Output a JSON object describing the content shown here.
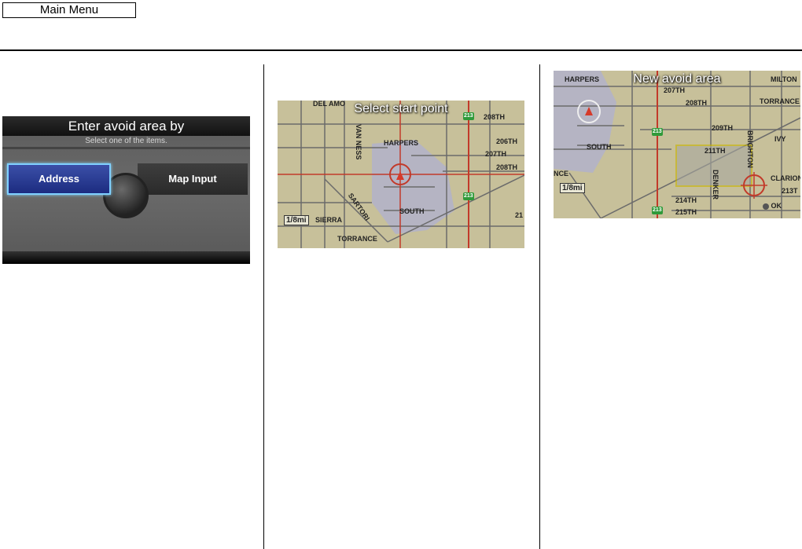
{
  "header": {
    "main_menu_label": "Main Menu"
  },
  "panel_avoid": {
    "title": "Enter avoid area by",
    "subtitle": "Select one of the items.",
    "address_label": "Address",
    "map_input_label": "Map Input"
  },
  "map_start": {
    "title": "Select start point",
    "scale": "1/8mi",
    "labels": [
      "DEL AMO",
      "208TH",
      "VAN NESS",
      "HARPERS",
      "206TH",
      "207TH",
      "208TH",
      "SOUTH",
      "SIERRA",
      "TORRANCE",
      "SARTORI",
      "21"
    ],
    "shields": [
      "213",
      "213"
    ]
  },
  "map_avoid": {
    "title": "New avoid area",
    "scale": "1/8mi",
    "ok_label": "OK",
    "labels": [
      "HARPERS",
      "207TH",
      "MILTON",
      "208TH",
      "TORRANCE",
      "209TH",
      "IVY",
      "SOUTH",
      "211TH",
      "BRIGHTON",
      "CLARION",
      "213T",
      "DENKER",
      "214TH",
      "215TH",
      "NCE"
    ],
    "shields": [
      "213",
      "213"
    ]
  }
}
